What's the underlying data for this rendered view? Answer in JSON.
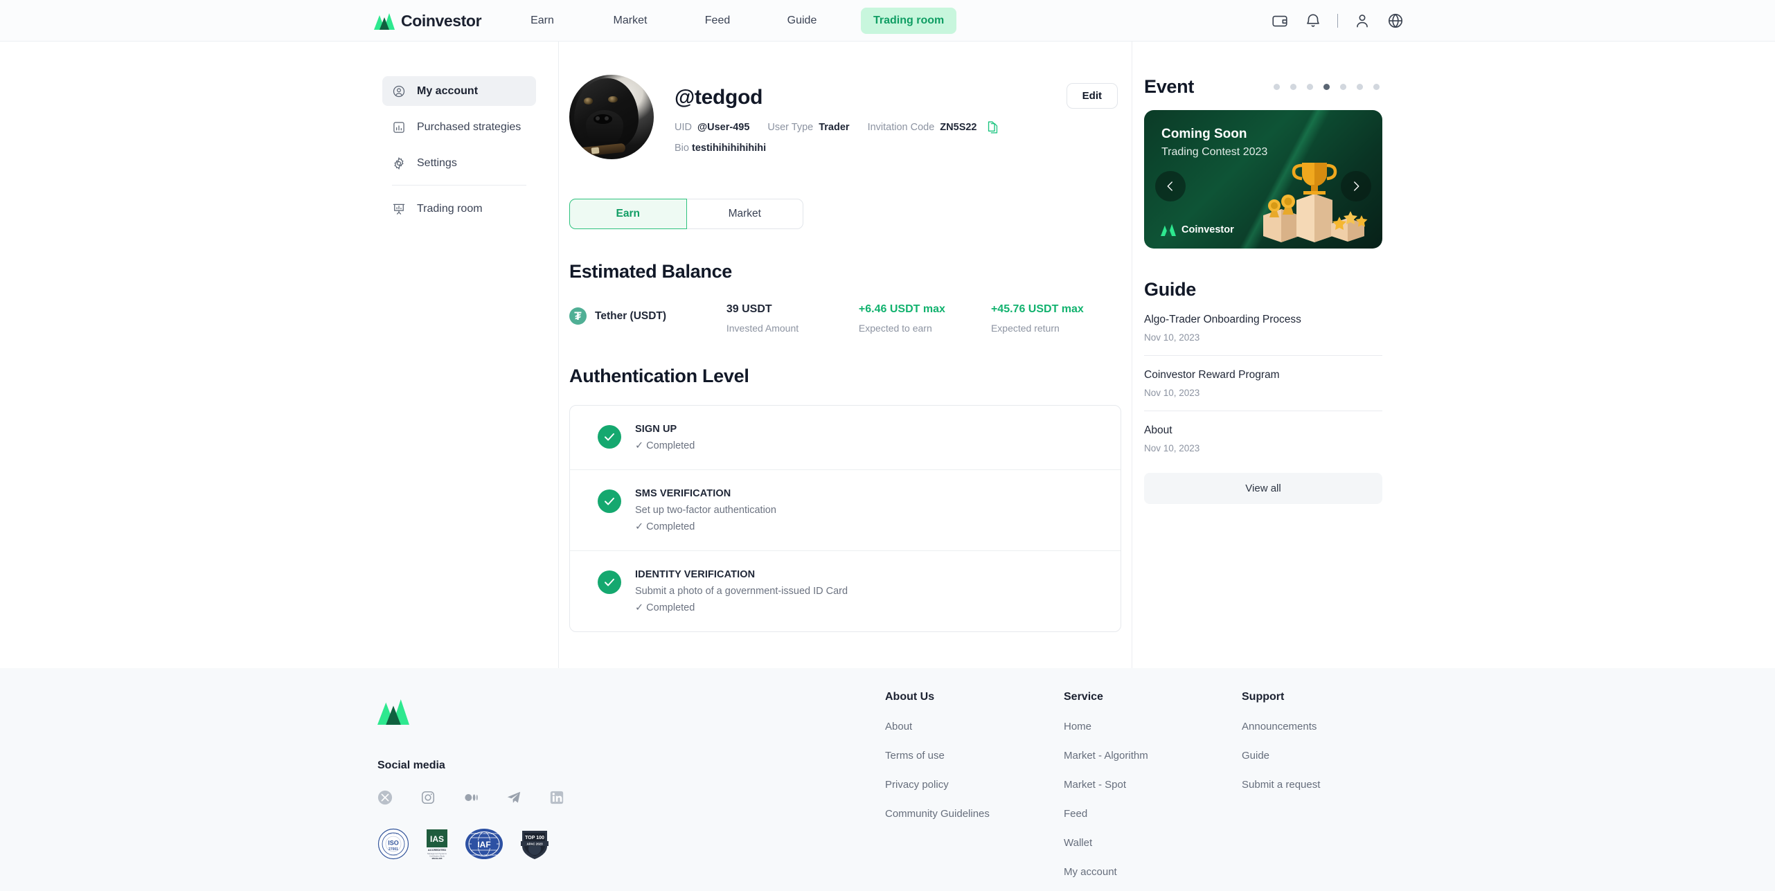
{
  "header": {
    "brand": "Coinvestor",
    "nav": [
      {
        "label": "Earn",
        "active": false
      },
      {
        "label": "Market",
        "active": false
      },
      {
        "label": "Feed",
        "active": false
      },
      {
        "label": "Guide",
        "active": false
      },
      {
        "label": "Trading room",
        "active": true
      }
    ],
    "icons": [
      "wallet-icon",
      "bell-icon",
      "user-icon",
      "globe-icon"
    ]
  },
  "sidebar": {
    "items": [
      {
        "label": "My account",
        "icon": "user-circle-icon",
        "active": true
      },
      {
        "label": "Purchased strategies",
        "icon": "bar-chart-icon",
        "active": false
      },
      {
        "label": "Settings",
        "icon": "gear-icon",
        "active": false
      },
      {
        "label": "Trading room",
        "icon": "presentation-chart-icon",
        "active": false
      }
    ]
  },
  "profile": {
    "handle": "@tedgod",
    "uid_label": "UID",
    "uid_value": "@User-495",
    "usertype_label": "User Type",
    "usertype_value": "Trader",
    "invite_label": "Invitation Code",
    "invite_value": "ZN5S22",
    "bio_label": "Bio",
    "bio_value": "testihihihihihihi",
    "edit_label": "Edit"
  },
  "tabs": [
    {
      "label": "Earn",
      "active": true
    },
    {
      "label": "Market",
      "active": false
    }
  ],
  "balance": {
    "title": "Estimated Balance",
    "coin_name": "Tether (USDT)",
    "columns": [
      {
        "value": "39 USDT",
        "label": "Invested Amount",
        "positive": false
      },
      {
        "value": "+6.46 USDT max",
        "label": "Expected to earn",
        "positive": true
      },
      {
        "value": "+45.76 USDT max",
        "label": "Expected return",
        "positive": true
      }
    ]
  },
  "auth": {
    "title": "Authentication Level",
    "items": [
      {
        "name": "SIGN UP",
        "desc": "",
        "status": "✓ Completed"
      },
      {
        "name": "SMS VERIFICATION",
        "desc": "Set up two-factor authentication",
        "status": "✓ Completed"
      },
      {
        "name": "IDENTITY VERIFICATION",
        "desc": "Submit a photo of a government-issued ID Card",
        "status": "✓ Completed"
      }
    ]
  },
  "event": {
    "title": "Event",
    "dots_total": 7,
    "dot_active_index": 3,
    "card_title": "Coming Soon",
    "card_subtitle": "Trading Contest 2023",
    "brand": "Coinvestor"
  },
  "guide": {
    "title": "Guide",
    "items": [
      {
        "name": "Algo-Trader Onboarding Process",
        "date": "Nov 10, 2023"
      },
      {
        "name": "Coinvestor Reward Program",
        "date": "Nov 10, 2023"
      },
      {
        "name": "About",
        "date": "Nov 10, 2023"
      }
    ],
    "view_all": "View all"
  },
  "footer": {
    "social_title": "Social media",
    "socials": [
      "x-icon",
      "instagram-icon",
      "medium-icon",
      "telegram-icon",
      "linkedin-icon"
    ],
    "badges": [
      "iso-27001-badge",
      "ias-accredited-badge",
      "iaf-badge",
      "top-100-apac-2023-badge"
    ],
    "columns": [
      {
        "title": "About Us",
        "links": [
          "About",
          "Terms of use",
          "Privacy policy",
          "Community Guidelines"
        ]
      },
      {
        "title": "Service",
        "links": [
          "Home",
          "Market - Algorithm",
          "Market - Spot",
          "Feed",
          "Wallet",
          "My account"
        ]
      },
      {
        "title": "Support",
        "links": [
          "Announcements",
          "Guide",
          "Submit a request"
        ]
      }
    ]
  },
  "colors": {
    "brand_green": "#2ec27e",
    "accent_green": "#0f9d63",
    "text_dark": "#111827",
    "text_muted": "#8c93a1"
  }
}
